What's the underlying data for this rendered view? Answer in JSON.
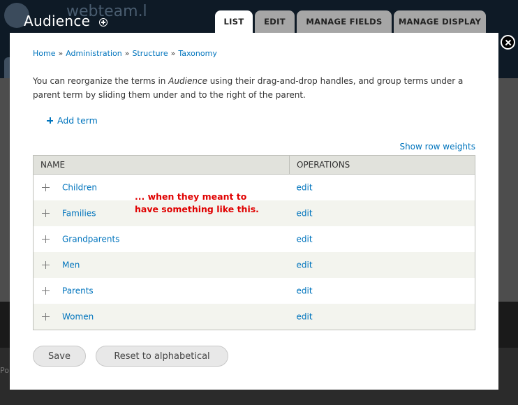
{
  "background": {
    "site_name": "webteam.l",
    "footer_text": "Po"
  },
  "overlay": {
    "title": "Audience",
    "tabs": [
      {
        "label": "List",
        "active": true
      },
      {
        "label": "Edit",
        "active": false
      },
      {
        "label": "Manage fields",
        "active": false
      },
      {
        "label": "Manage display",
        "active": false
      }
    ]
  },
  "breadcrumb": {
    "items": [
      "Home",
      "Administration",
      "Structure",
      "Taxonomy"
    ],
    "separator": "»"
  },
  "help": {
    "before": "You can reorganize the terms in ",
    "vocab": "Audience",
    "after": " using their drag-and-drop handles, and group terms under a parent term by sliding them under and to the right of the parent."
  },
  "actions": {
    "add_term": "Add term",
    "show_row_weights": "Show row weights"
  },
  "table": {
    "headers": [
      "Name",
      "Operations"
    ],
    "rows": [
      {
        "name": "Children",
        "op": "edit"
      },
      {
        "name": "Families",
        "op": "edit"
      },
      {
        "name": "Grandparents",
        "op": "edit"
      },
      {
        "name": "Men",
        "op": "edit"
      },
      {
        "name": "Parents",
        "op": "edit"
      },
      {
        "name": "Women",
        "op": "edit"
      }
    ]
  },
  "annotation": {
    "line1": "... when they meant to",
    "line2": "have something like this."
  },
  "buttons": {
    "save": "Save",
    "reset": "Reset to alphabetical"
  },
  "colors": {
    "link": "#0074bd",
    "annotation": "#e00000",
    "header_bg": "#e1e2dc",
    "even_row_bg": "#f3f4ee"
  }
}
